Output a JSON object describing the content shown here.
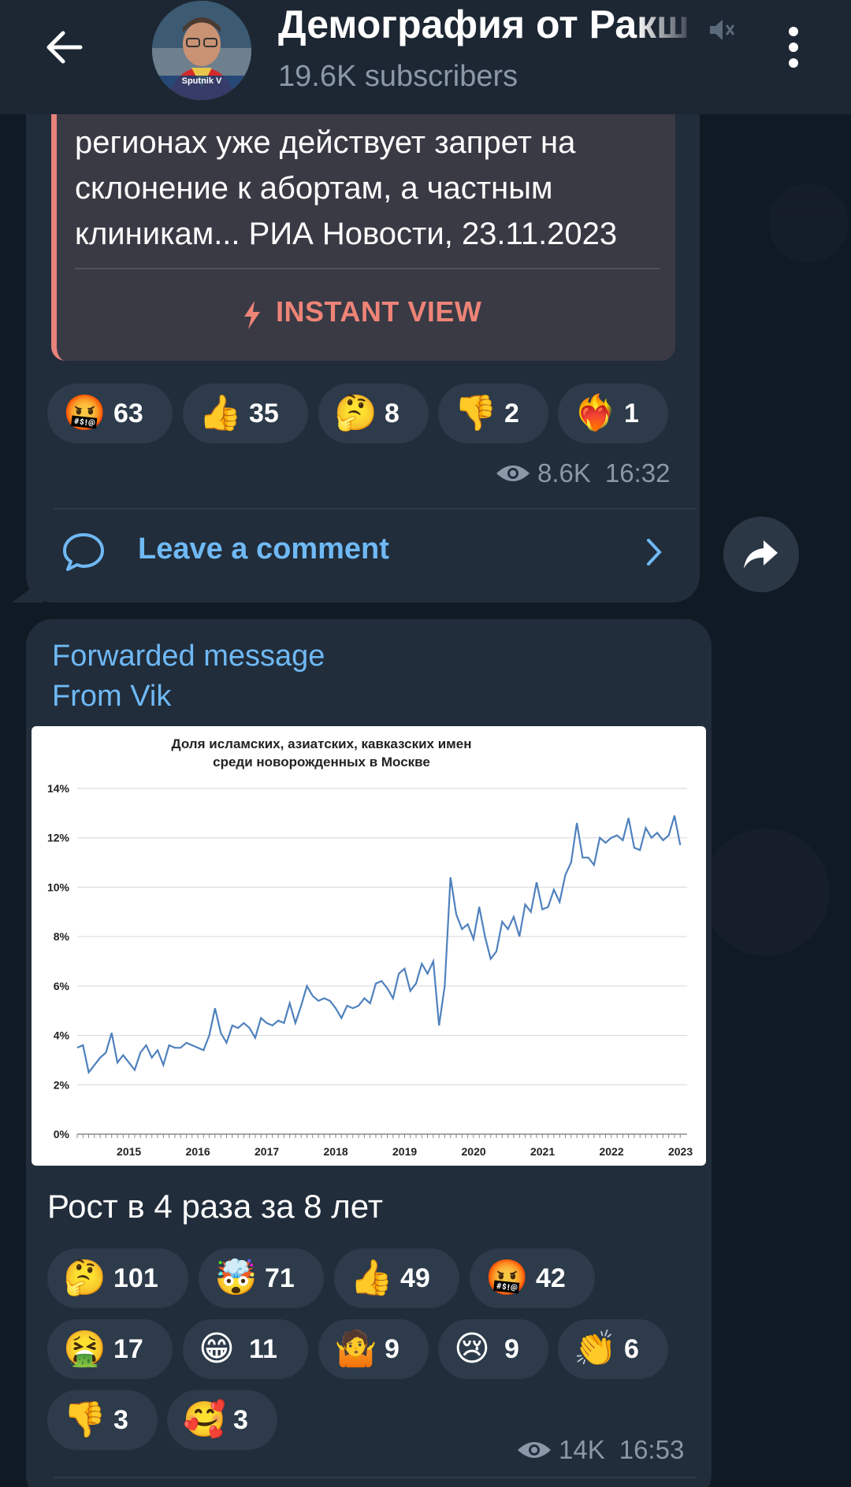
{
  "header": {
    "channel_title": "Демография от Ракш",
    "subscribers": "19.6K subscribers",
    "avatar_label": "Sputnik V"
  },
  "post1": {
    "preview_lines": [
      "регионах уже действует запрет на",
      "склонение к абортам, а частным",
      "клиникам... РИА Новости, 23.11.2023"
    ],
    "instant_view": "INSTANT VIEW",
    "reactions": [
      {
        "emoji": "🤬",
        "count": "63"
      },
      {
        "emoji": "👍",
        "count": "35"
      },
      {
        "emoji": "🤔",
        "count": "8"
      },
      {
        "emoji": "👎",
        "count": "2"
      },
      {
        "emoji": "❤️‍🔥",
        "count": "1"
      }
    ],
    "views": "8.6K",
    "time": "16:32",
    "comment_label": "Leave a comment"
  },
  "post2": {
    "forwarded": "Forwarded message",
    "from": "From Vik",
    "caption": "Рост в 4 раза за 8 лет",
    "reactions": [
      {
        "emoji": "🤔",
        "count": "101"
      },
      {
        "emoji": "🤯",
        "count": "71"
      },
      {
        "emoji": "👍",
        "count": "49"
      },
      {
        "emoji": "🤬",
        "count": "42"
      },
      {
        "emoji": "🤮",
        "count": "17"
      },
      {
        "emoji": "😁",
        "count": "11"
      },
      {
        "emoji": "🤷",
        "count": "9"
      },
      {
        "emoji": "😢",
        "count": "9"
      },
      {
        "emoji": "👏",
        "count": "6"
      },
      {
        "emoji": "👎",
        "count": "3"
      },
      {
        "emoji": "🥰",
        "count": "3"
      }
    ],
    "views": "14K",
    "time": "16:53"
  },
  "chart_data": {
    "type": "line",
    "title_lines": [
      "Доля исламских, азиатских, кавказских имен",
      "среди новорожденных в Москве"
    ],
    "xlabel": "",
    "ylabel": "",
    "ylim": [
      0,
      14
    ],
    "yticks": [
      "0%",
      "2%",
      "4%",
      "6%",
      "8%",
      "10%",
      "12%",
      "14%"
    ],
    "xticks": [
      "2015",
      "2016",
      "2017",
      "2018",
      "2019",
      "2020",
      "2021",
      "2022",
      "2023"
    ],
    "grid": true,
    "line_color": "#4f81bd",
    "series": [
      {
        "x_start": 2014.7,
        "x_step": 0.0833,
        "values": [
          3.5,
          3.6,
          2.5,
          2.8,
          3.1,
          3.3,
          4.1,
          2.9,
          3.2,
          2.9,
          2.6,
          3.3,
          3.6,
          3.1,
          3.4,
          2.8,
          3.6,
          3.5,
          3.5,
          3.7,
          3.6,
          3.5,
          3.4,
          4.0,
          5.1,
          4.1,
          3.7,
          4.4,
          4.3,
          4.5,
          4.3,
          3.9,
          4.7,
          4.5,
          4.4,
          4.6,
          4.5,
          5.3,
          4.5,
          5.2,
          6.0,
          5.6,
          5.4,
          5.5,
          5.4,
          5.1,
          4.7,
          5.2,
          5.1,
          5.2,
          5.5,
          5.3,
          6.1,
          6.2,
          5.9,
          5.5,
          6.5,
          6.7,
          5.8,
          6.1,
          6.9,
          6.5,
          7.0,
          4.4,
          6.0,
          10.4,
          8.9,
          8.3,
          8.5,
          7.9,
          9.2,
          8.0,
          7.1,
          7.4,
          8.6,
          8.3,
          8.8,
          8.0,
          9.3,
          9.0,
          10.2,
          9.1,
          9.2,
          9.9,
          9.4,
          10.5,
          11.0,
          12.6,
          11.2,
          11.2,
          10.9,
          12.0,
          11.8,
          12.0,
          12.1,
          11.9,
          12.8,
          11.6,
          11.5,
          12.4,
          12.0,
          12.2,
          11.9,
          12.1,
          12.9,
          11.7
        ]
      }
    ]
  }
}
